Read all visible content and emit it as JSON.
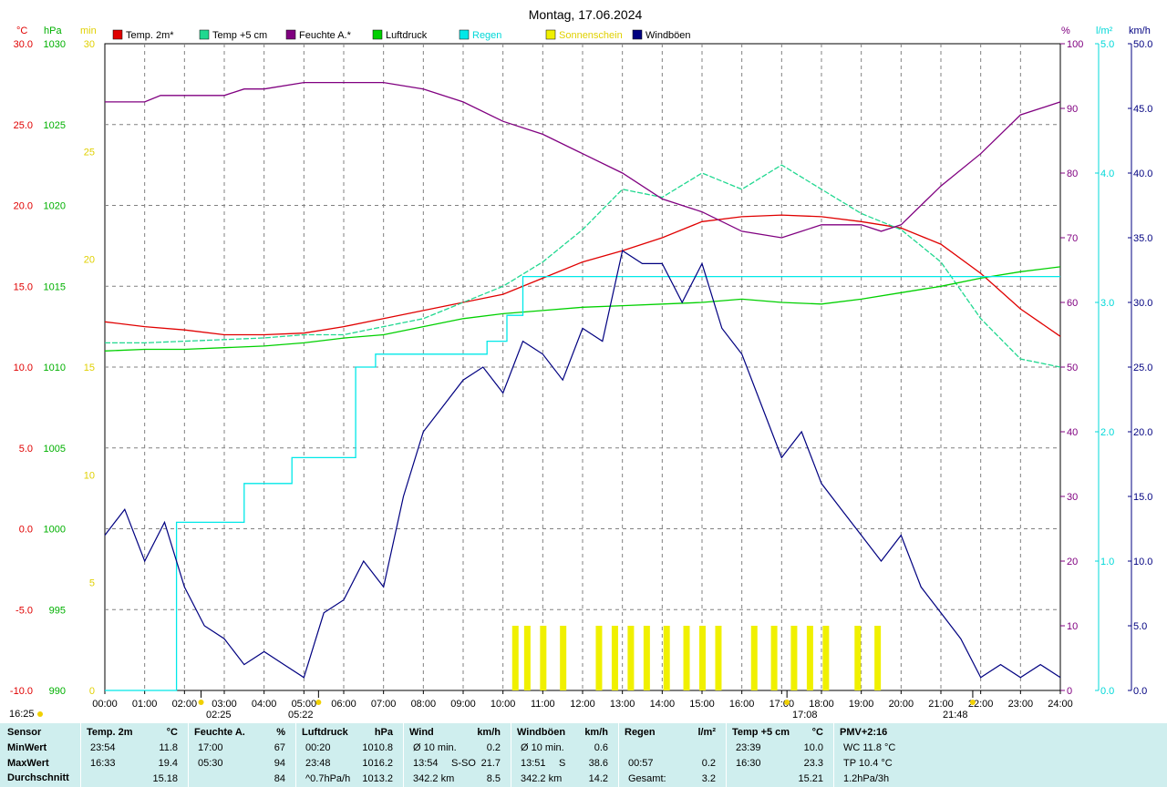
{
  "title": "Montag, 17.06.2024",
  "legend": [
    {
      "label": "Temp. 2m*",
      "color": "#e00000"
    },
    {
      "label": "Temp +5 cm",
      "color": "#20d890"
    },
    {
      "label": "Feuchte A.*",
      "color": "#800080"
    },
    {
      "label": "Luftdruck",
      "color": "#00d000"
    },
    {
      "label": "Regen",
      "color": "#00e8e8"
    },
    {
      "label": "Sonnenschein",
      "color": "#f0f000"
    },
    {
      "label": "Windböen",
      "color": "#000080"
    }
  ],
  "axis_units": {
    "temp": "°C",
    "press": "hPa",
    "sun": "min",
    "hum": "%",
    "rain": "l/m²",
    "wind": "km/h"
  },
  "axis_ticks": {
    "temp": [
      "30.0",
      "25.0",
      "20.0",
      "15.0",
      "10.0",
      "5.0",
      "0.0",
      "-5.0",
      "-10.0"
    ],
    "press": [
      "1030",
      "1025",
      "1020",
      "1015",
      "1010",
      "1005",
      "1000",
      "995",
      "990"
    ],
    "sun": [
      "30",
      "25",
      "20",
      "15",
      "10",
      "5",
      "0"
    ],
    "hum": [
      "100",
      "90",
      "80",
      "70",
      "60",
      "50",
      "40",
      "30",
      "20",
      "10",
      "0"
    ],
    "rain": [
      "5.0",
      "4.0",
      "3.0",
      "2.0",
      "1.0",
      "0.0"
    ],
    "wind": [
      "50.0",
      "45.0",
      "40.0",
      "35.0",
      "30.0",
      "25.0",
      "20.0",
      "15.0",
      "10.0",
      "5.0",
      "0.0"
    ],
    "time": [
      "00:00",
      "01:00",
      "02:00",
      "03:00",
      "04:00",
      "05:00",
      "06:00",
      "07:00",
      "08:00",
      "09:00",
      "10:00",
      "11:00",
      "12:00",
      "13:00",
      "14:00",
      "15:00",
      "16:00",
      "17:00",
      "18:00",
      "19:00",
      "20:00",
      "21:00",
      "22:00",
      "23:00",
      "24:00"
    ]
  },
  "markers": {
    "moonrise": "16:25",
    "sunrise": "05:22",
    "sunset": "21:48",
    "moonset": "02:25",
    "moon_culmination": "17:08"
  },
  "chart_data": {
    "type": "line",
    "title": "Montag, 17.06.2024",
    "x_unit": "hours",
    "xlim": [
      0,
      24
    ],
    "ylim_temp": [
      -10,
      30
    ],
    "ylim_pressure": [
      990,
      1030
    ],
    "ylim_humidity": [
      0,
      100
    ],
    "ylim_rain": [
      0,
      5
    ],
    "ylim_wind": [
      0,
      50
    ],
    "ylim_sun": [
      0,
      30
    ],
    "series": [
      {
        "name": "Temp. 2m*",
        "axis": "temp",
        "color": "#e00000",
        "x": [
          0,
          1,
          2,
          3,
          4,
          5,
          6,
          7,
          8,
          9,
          10,
          11,
          12,
          13,
          14,
          15,
          16,
          17,
          18,
          19,
          20,
          21,
          22,
          23,
          24
        ],
        "y": [
          12.8,
          12.5,
          12.3,
          12.0,
          12.0,
          12.1,
          12.5,
          13.0,
          13.5,
          14.0,
          14.5,
          15.5,
          16.5,
          17.2,
          18.0,
          19.0,
          19.3,
          19.4,
          19.3,
          19.0,
          18.6,
          17.6,
          15.8,
          13.6,
          11.9
        ]
      },
      {
        "name": "Temp +5 cm",
        "axis": "temp",
        "color": "#20d890",
        "x": [
          0,
          1,
          2,
          3,
          4,
          5,
          6,
          7,
          8,
          9,
          10,
          11,
          12,
          13,
          14,
          15,
          16,
          17,
          18,
          19,
          20,
          21,
          22,
          23,
          24
        ],
        "y": [
          11.5,
          11.5,
          11.6,
          11.7,
          11.8,
          12.0,
          12.0,
          12.5,
          13.0,
          14.0,
          15.0,
          16.5,
          18.5,
          21.0,
          20.5,
          22.0,
          21.0,
          22.5,
          21.0,
          19.5,
          18.5,
          16.5,
          13.0,
          10.5,
          10.0
        ]
      },
      {
        "name": "Feuchte A.*",
        "axis": "hum",
        "color": "#800080",
        "x": [
          0,
          1,
          1.4,
          2,
          3,
          3.5,
          4,
          5,
          6,
          7,
          8,
          9,
          10,
          11,
          12,
          13,
          14,
          15,
          16,
          17,
          18,
          19,
          19.5,
          20,
          21,
          22,
          23,
          24
        ],
        "y": [
          91,
          91,
          92,
          92,
          92,
          93,
          93,
          94,
          94,
          94,
          93,
          91,
          88,
          86,
          83,
          80,
          76,
          74,
          71,
          70,
          72,
          72,
          71,
          72,
          78,
          83,
          89,
          91
        ]
      },
      {
        "name": "Luftdruck",
        "axis": "press",
        "color": "#00d000",
        "x": [
          0,
          1,
          2,
          3,
          4,
          5,
          6,
          7,
          8,
          9,
          10,
          11,
          12,
          13,
          14,
          15,
          16,
          17,
          18,
          19,
          20,
          21,
          22,
          23,
          24
        ],
        "y": [
          1011.0,
          1011.1,
          1011.1,
          1011.2,
          1011.3,
          1011.5,
          1011.8,
          1012.0,
          1012.5,
          1013.0,
          1013.3,
          1013.5,
          1013.7,
          1013.8,
          1013.9,
          1014.0,
          1014.2,
          1014.0,
          1013.9,
          1014.2,
          1014.6,
          1015.0,
          1015.5,
          1015.9,
          1016.2
        ]
      },
      {
        "name": "Regen",
        "axis": "rain",
        "color": "#00e8e8",
        "x": [
          0,
          1.4,
          1.8,
          2.6,
          3.5,
          4.7,
          6.3,
          6.8,
          9.6,
          10.1,
          10.5,
          24
        ],
        "y": [
          0,
          0,
          1.3,
          1.3,
          1.6,
          1.8,
          2.5,
          2.6,
          2.7,
          2.9,
          3.2,
          3.2
        ]
      },
      {
        "name": "Windböen",
        "axis": "wind",
        "color": "#000080",
        "x": [
          0,
          0.5,
          1,
          1.5,
          2,
          2.5,
          3,
          3.5,
          4,
          4.5,
          5,
          5.5,
          6,
          6.5,
          7,
          7.5,
          8,
          8.5,
          9,
          9.5,
          10,
          10.5,
          11,
          11.5,
          12,
          12.5,
          13,
          13.5,
          14,
          14.5,
          15,
          15.5,
          16,
          16.5,
          17,
          17.5,
          18,
          18.5,
          19,
          19.5,
          20,
          20.5,
          21,
          21.5,
          22,
          22.5,
          23,
          23.5,
          24
        ],
        "y": [
          12,
          14,
          10,
          13,
          8,
          5,
          4,
          2,
          3,
          2,
          1,
          6,
          7,
          10,
          8,
          15,
          20,
          22,
          24,
          25,
          23,
          27,
          26,
          24,
          28,
          27,
          34,
          33,
          33,
          30,
          33,
          28,
          26,
          22,
          18,
          20,
          16,
          14,
          12,
          10,
          12,
          8,
          6,
          4,
          1,
          2,
          1,
          2,
          1
        ]
      },
      {
        "name": "Sonnenschein",
        "axis": "sun",
        "color": "#f0f000",
        "x": [
          10.3,
          10.6,
          11.0,
          11.5,
          12.4,
          12.8,
          13.2,
          13.6,
          14.1,
          14.6,
          15.0,
          15.4,
          16.3,
          16.8,
          17.3,
          17.7,
          18.1,
          18.9,
          19.4
        ],
        "y": [
          3,
          3,
          3,
          3,
          3,
          3,
          3,
          3,
          3,
          3,
          3,
          3,
          3,
          3,
          3,
          3,
          3,
          3,
          3
        ]
      }
    ]
  },
  "table": {
    "row_labels": [
      "Sensor",
      "MinWert",
      "MaxWert",
      "Durchschnitt"
    ],
    "columns": [
      {
        "title": "Temp. 2m",
        "unit": "°C",
        "rows": [
          [
            "23:54",
            "",
            "11.8"
          ],
          [
            "16:33",
            "",
            "19.4"
          ],
          [
            "",
            "",
            "15.18"
          ]
        ]
      },
      {
        "title": "Feuchte A.",
        "unit": "%",
        "rows": [
          [
            "17:00",
            "",
            "67"
          ],
          [
            "05:30",
            "",
            "94"
          ],
          [
            "",
            "",
            "84"
          ]
        ]
      },
      {
        "title": "Luftdruck",
        "unit": "hPa",
        "rows": [
          [
            "00:20",
            "",
            "1010.8"
          ],
          [
            "23:48",
            "",
            "1016.2"
          ],
          [
            "^0.7hPa/h",
            "",
            "1013.2"
          ]
        ]
      },
      {
        "title": "Wind",
        "unit": "km/h",
        "rows": [
          [
            "Ø 10 min.",
            "",
            "0.2"
          ],
          [
            "13:54",
            "S-SO",
            "21.7"
          ],
          [
            "342.2 km",
            "",
            "8.5"
          ]
        ]
      },
      {
        "title": "Windböen",
        "unit": "km/h",
        "rows": [
          [
            "Ø 10 min.",
            "",
            "0.6"
          ],
          [
            "13:51",
            "S",
            "38.6"
          ],
          [
            "342.2 km",
            "",
            "14.2"
          ]
        ]
      },
      {
        "title": "Regen",
        "unit": "l/m²",
        "rows": [
          [
            "",
            "",
            ""
          ],
          [
            "00:57",
            "",
            "0.2"
          ],
          [
            "Gesamt:",
            "",
            "3.2"
          ]
        ]
      },
      {
        "title": "Temp +5 cm",
        "unit": "°C",
        "rows": [
          [
            "23:39",
            "",
            "10.0"
          ],
          [
            "16:30",
            "",
            "23.3"
          ],
          [
            "",
            "",
            "15.21"
          ]
        ]
      },
      {
        "title": "PMV+2:16",
        "unit": "",
        "rows": [
          [
            "WC 11.8 °C",
            "",
            ""
          ],
          [
            "TP 10.4 °C",
            "",
            ""
          ],
          [
            "1.2hPa/3h",
            "",
            ""
          ]
        ]
      }
    ]
  }
}
